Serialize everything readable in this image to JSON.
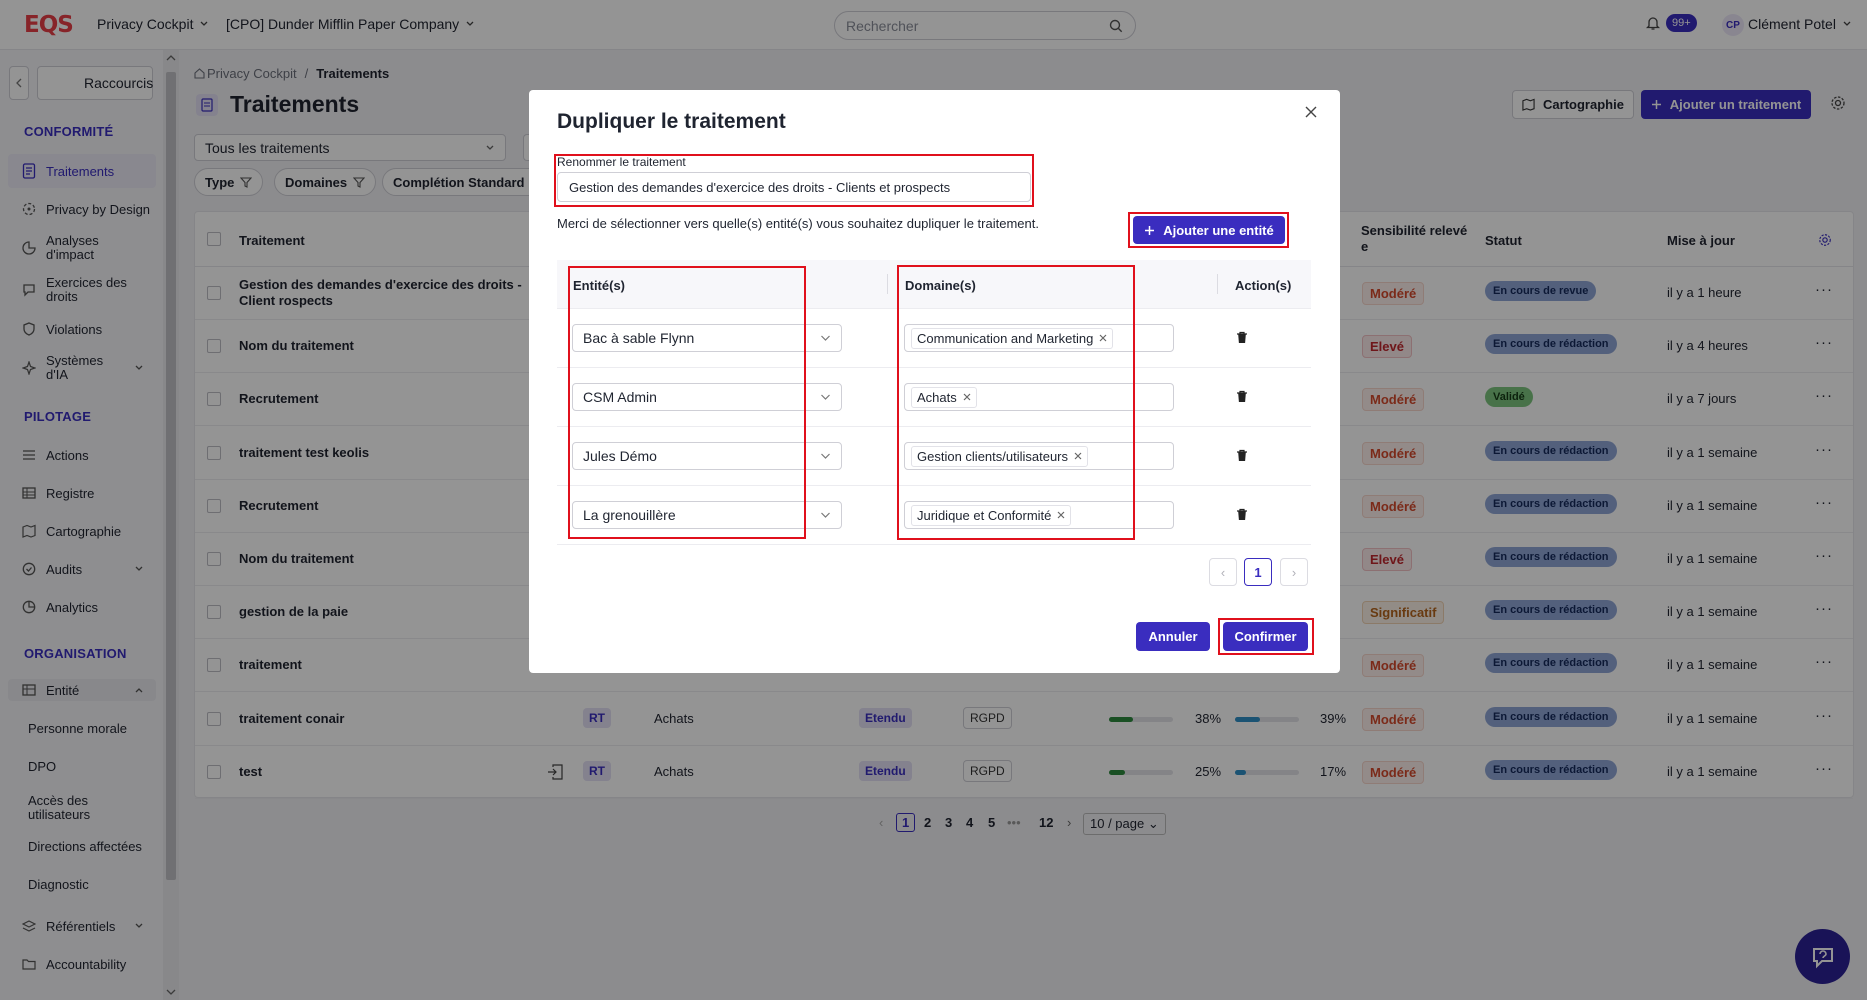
{
  "header": {
    "logo": "EQS",
    "workspace": "Privacy Cockpit",
    "company": "[CPO] Dunder Mifflin Paper Company",
    "search_placeholder": "Rechercher",
    "notif_count": "99+",
    "user_initials": "CP",
    "user_name": "Clément Potel"
  },
  "sidebar": {
    "shortcuts": "Raccourcis",
    "sections": {
      "conformite": "CONFORMITÉ",
      "pilotage": "PILOTAGE",
      "organisation": "ORGANISATION"
    },
    "conformite_items": [
      "Traitements",
      "Privacy by Design",
      "Analyses d'impact",
      "Exercices des droits",
      "Violations",
      "Systèmes d'IA"
    ],
    "pilotage_items": [
      "Actions",
      "Registre",
      "Cartographie",
      "Audits",
      "Analytics"
    ],
    "organisation_items": [
      "Entité",
      "Personne morale",
      "DPO",
      "Accès des utilisateurs",
      "Directions affectées",
      "Diagnostic",
      "Référentiels",
      "Accountability"
    ]
  },
  "page": {
    "breadcrumb_root": "Privacy Cockpit",
    "breadcrumb_current": "Traitements",
    "title": "Traitements",
    "btn_cartographie": "Cartographie",
    "btn_add": "Ajouter un traitement",
    "filter_select": "Tous les traitements",
    "chips": [
      "Type",
      "Domaines",
      "Complétion Standard"
    ]
  },
  "table": {
    "headers": {
      "traitement": "Traitement",
      "sensibilite": "Sensibilité relevé e",
      "statut": "Statut",
      "maj": "Mise à jour"
    },
    "rows": [
      {
        "name": "Gestion des demandes d'exercice des droits - Client rospects",
        "sens": "Modéré",
        "status": "En cours de revue",
        "upd": "il y a 1 heure"
      },
      {
        "name": "Nom du traitement",
        "sens": "Elevé",
        "status": "En cours de rédaction",
        "upd": "il y a 4 heures"
      },
      {
        "name": "Recrutement",
        "sens": "Modéré",
        "status": "Validé",
        "upd": "il y a 7 jours"
      },
      {
        "name": "traitement test keolis",
        "sens": "Modéré",
        "status": "En cours de rédaction",
        "upd": "il y a 1 semaine"
      },
      {
        "name": "Recrutement",
        "sens": "Modéré",
        "status": "En cours de rédaction",
        "upd": "il y a 1 semaine"
      },
      {
        "name": "Nom du traitement",
        "sens": "Elevé",
        "status": "En cours de rédaction",
        "upd": "il y a 1 semaine"
      },
      {
        "name": "gestion de la paie",
        "sens": "Significatif",
        "status": "En cours de rédaction",
        "upd": "il y a 1 semaine"
      },
      {
        "name": "traitement",
        "sens": "Modéré",
        "status": "En cours de rédaction",
        "upd": "il y a 1 semaine"
      },
      {
        "name": "traitement conair",
        "type": "RT",
        "domain": "Achats",
        "scope": "Etendu",
        "framework": "RGPD",
        "p1": "38%",
        "p2": "39%",
        "sens": "Modéré",
        "status": "En cours de rédaction",
        "upd": "il y a 1 semaine"
      },
      {
        "name": "test",
        "type": "RT",
        "domain": "Achats",
        "scope": "Etendu",
        "framework": "RGPD",
        "p1": "25%",
        "p2": "17%",
        "sens": "Modéré",
        "status": "En cours de rédaction",
        "upd": "il y a 1 semaine"
      }
    ],
    "progress": {
      "conair_1": 0.38,
      "conair_2": 0.39,
      "test_1": 0.25,
      "test_2": 0.17
    },
    "pagination": {
      "pages": [
        "1",
        "2",
        "3",
        "4",
        "5",
        "•••",
        "12"
      ],
      "page_size": "10 / page"
    }
  },
  "modal": {
    "title": "Dupliquer le traitement",
    "rename_label": "Renommer le traitement",
    "rename_value": "Gestion des demandes d'exercice des droits - Clients et prospects",
    "info": "Merci de sélectionner vers quelle(s) entité(s) vous souhaitez dupliquer le traitement.",
    "add_entity": "Ajouter une entité",
    "col_entity": "Entité(s)",
    "col_domain": "Domaine(s)",
    "col_actions": "Action(s)",
    "rows": [
      {
        "entity": "Bac à sable Flynn",
        "domain": "Communication and Marketing"
      },
      {
        "entity": "CSM Admin",
        "domain": "Achats"
      },
      {
        "entity": "Jules Démo",
        "domain": "Gestion clients/utilisateurs"
      },
      {
        "entity": "La grenouillère",
        "domain": "Juridique et Conformité"
      }
    ],
    "page": "1",
    "cancel": "Annuler",
    "confirm": "Confirmer"
  },
  "colors": {
    "accent": "#3a2dbf",
    "highlight": "#e0101c",
    "brand": "#e83e48"
  }
}
